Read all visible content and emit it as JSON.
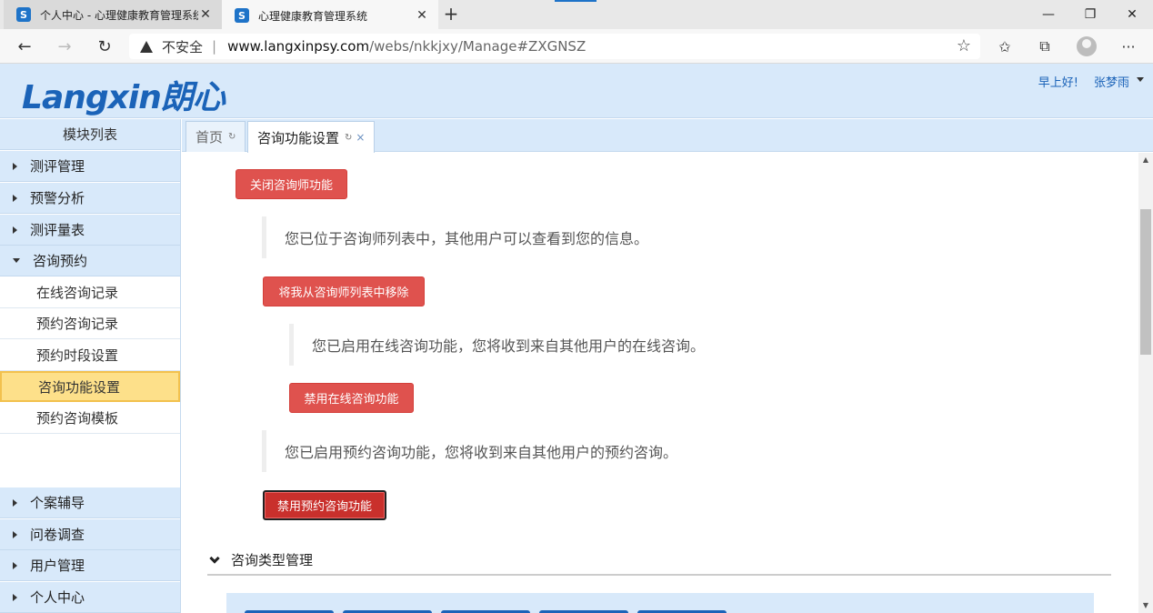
{
  "browser": {
    "tabs": [
      {
        "title": "个人中心 - 心理健康教育管理系统",
        "favicon": "S",
        "active": false
      },
      {
        "title": "心理健康教育管理系统",
        "favicon": "S",
        "active": true
      }
    ],
    "new_tab": "+",
    "window_controls": {
      "minimize": "—",
      "restore": "❐",
      "close": "✕"
    },
    "nav": {
      "back": "←",
      "forward": "→",
      "reload": "↻"
    },
    "address": {
      "security_label": "不安全",
      "separator": "|",
      "domain": "www.langxinpsy.com",
      "path": "/webs/nkkjxy/Manage#ZXGNSZ"
    },
    "toolbar": {
      "favorites": "☆",
      "collections": "⧉",
      "more": "···"
    }
  },
  "app": {
    "logo": "Langxin朗心",
    "greeting": "早上好!",
    "username": "张梦雨",
    "accent_color": "#1b63b8",
    "header_bg": "#d8e9fa"
  },
  "sidebar": {
    "title": "模块列表",
    "items_top": [
      {
        "label": "测评管理",
        "expanded": false
      },
      {
        "label": "预警分析",
        "expanded": false
      },
      {
        "label": "测评量表",
        "expanded": false
      },
      {
        "label": "咨询预约",
        "expanded": true
      }
    ],
    "sub_items": [
      {
        "label": "在线咨询记录",
        "selected": false
      },
      {
        "label": "预约咨询记录",
        "selected": false
      },
      {
        "label": "预约时段设置",
        "selected": false
      },
      {
        "label": "咨询功能设置",
        "selected": true
      },
      {
        "label": "预约咨询模板",
        "selected": false
      }
    ],
    "items_bottom": [
      {
        "label": "个案辅导"
      },
      {
        "label": "问卷调查"
      },
      {
        "label": "用户管理"
      },
      {
        "label": "个人中心"
      }
    ]
  },
  "content_tabs": [
    {
      "label": "首页",
      "refresh": "↻",
      "closable": false,
      "active": false
    },
    {
      "label": "咨询功能设置",
      "refresh": "↻",
      "close": "×",
      "closable": true,
      "active": true
    }
  ],
  "main": {
    "counselor_button": "关闭咨询师功能",
    "counselor_note": "您已位于咨询师列表中，其他用户可以查看到您的信息。",
    "remove_button": "将我从咨询师列表中移除",
    "online_note": "您已启用在线咨询功能，您将收到来自其他用户的在线咨询。",
    "online_button": "禁用在线咨询功能",
    "appointment_note": "您已启用预约咨询功能，您将收到来自其他用户的预约咨询。",
    "appointment_button": "禁用预约咨询功能",
    "section_title": "咨询类型管理",
    "button_color": "#df524e"
  }
}
